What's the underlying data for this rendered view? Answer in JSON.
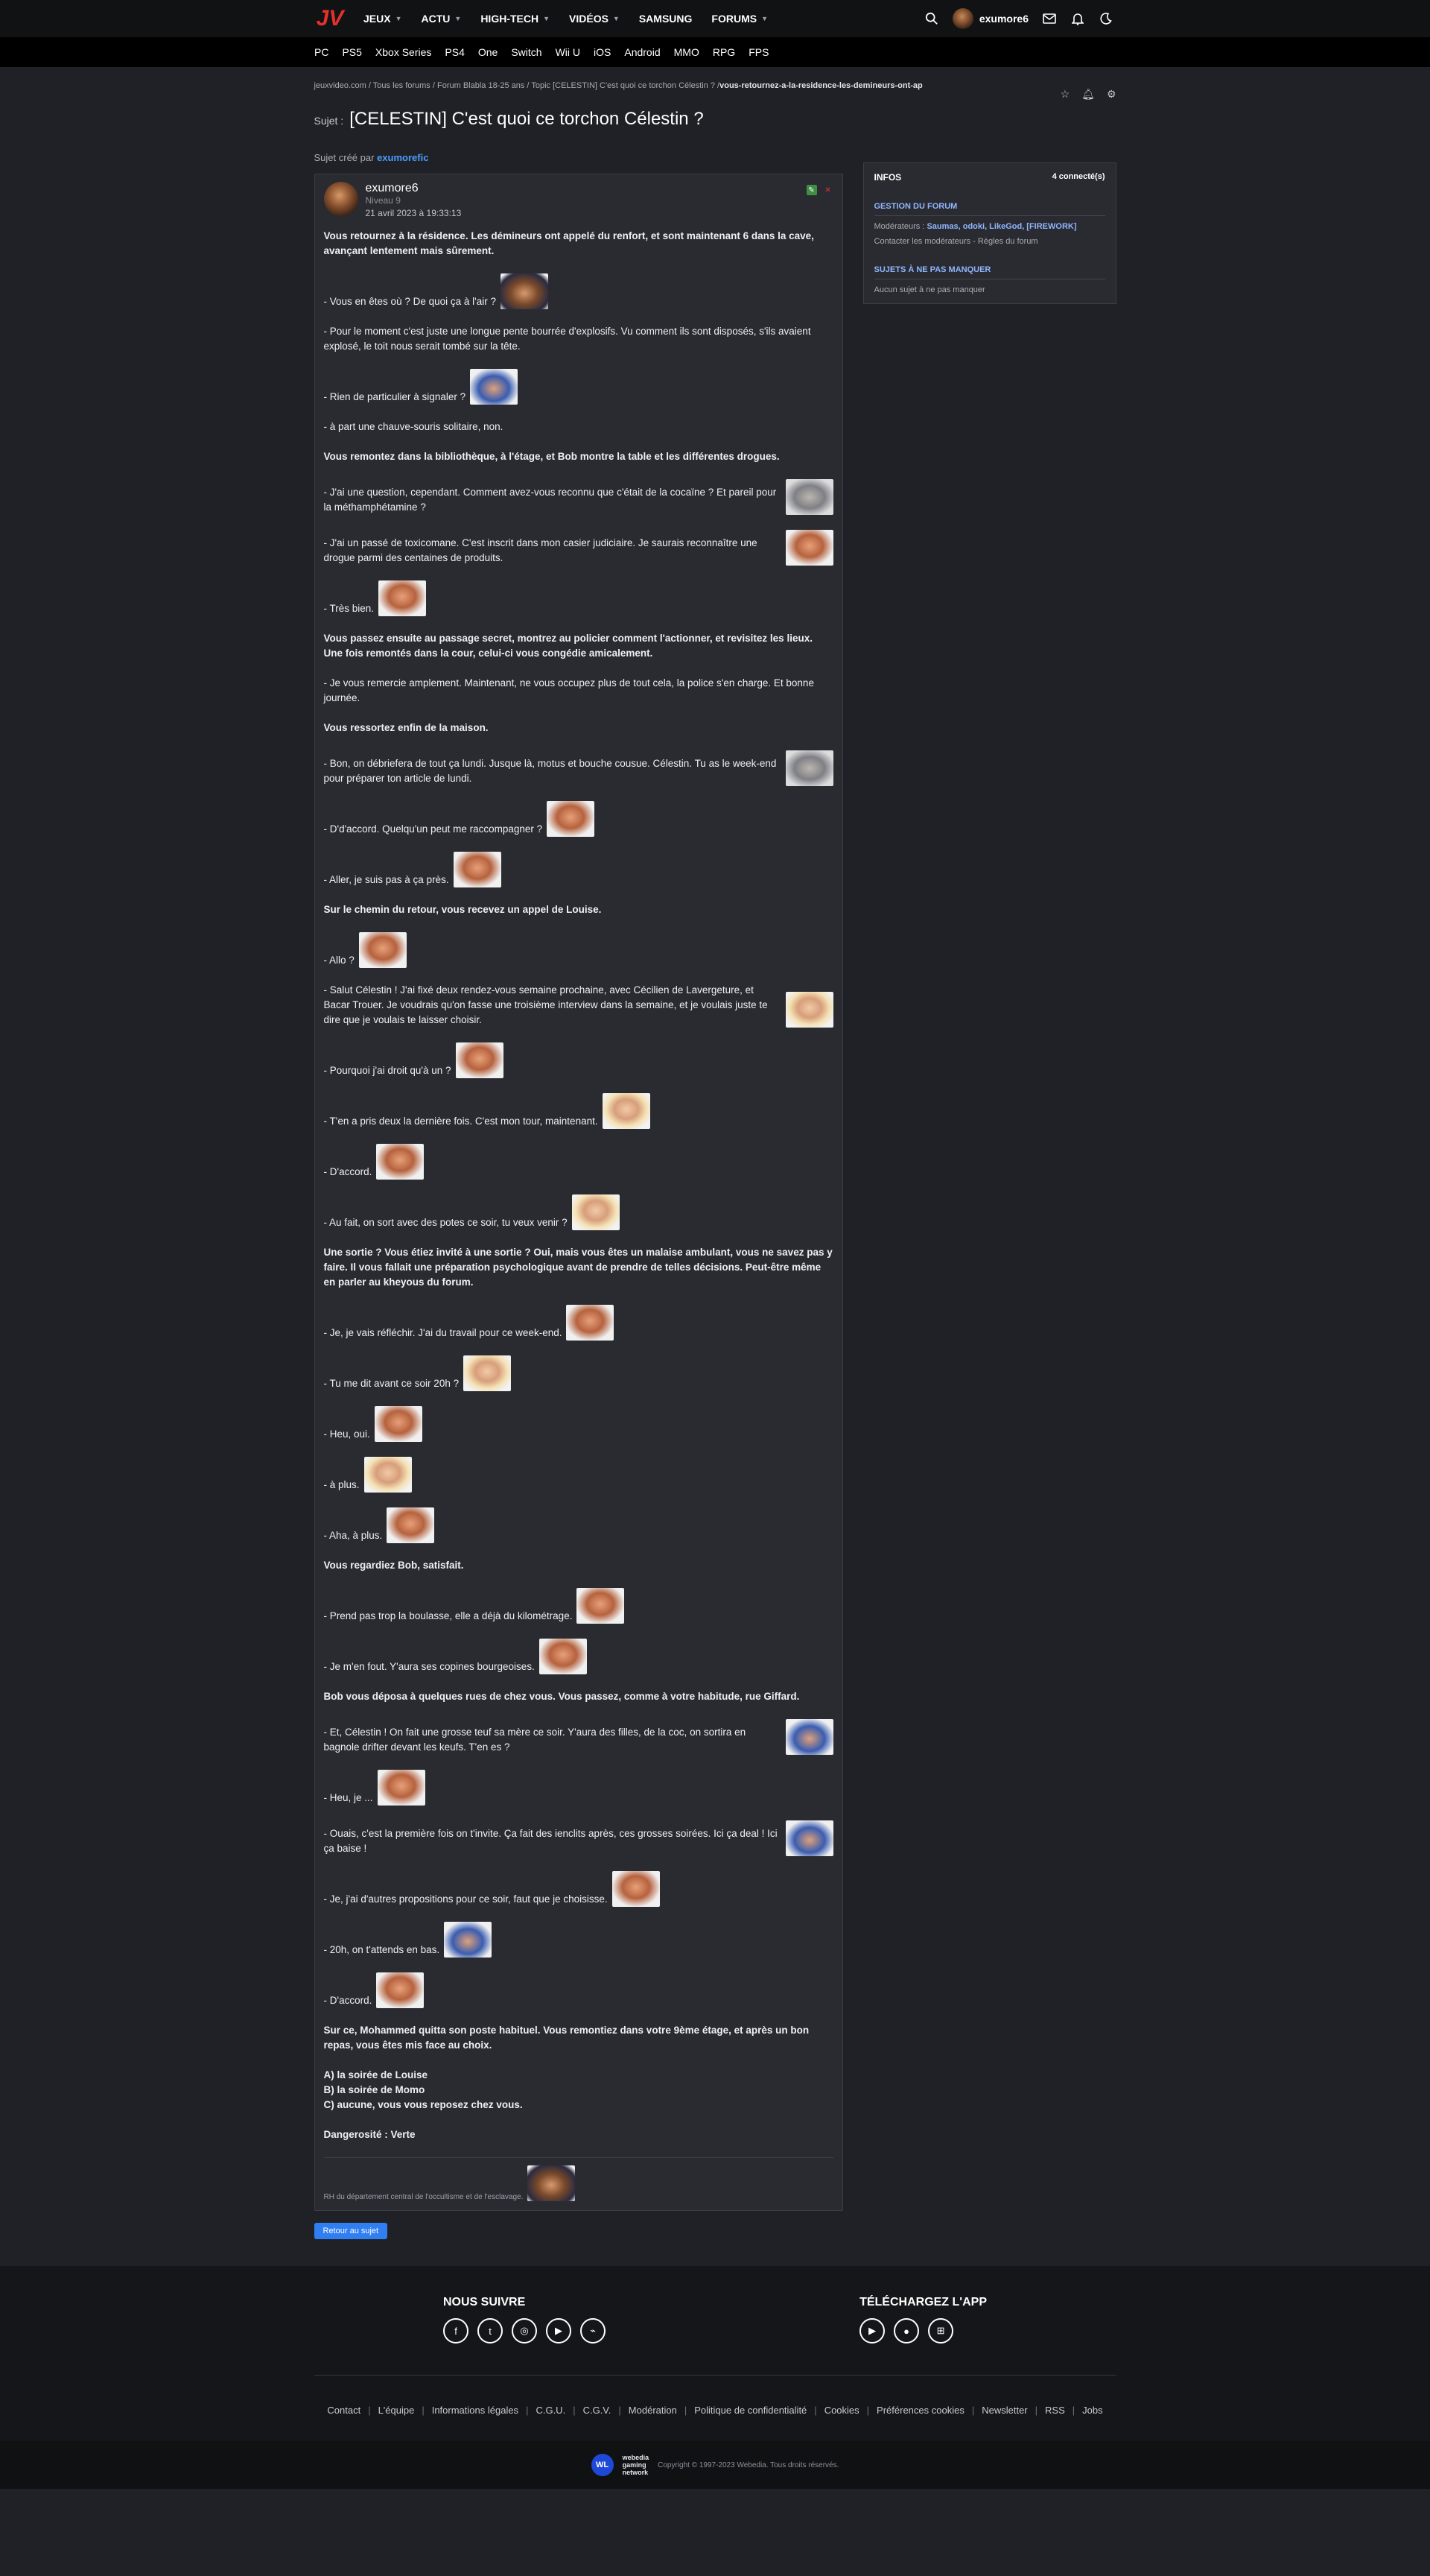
{
  "header": {
    "logo_text": "JV",
    "nav": [
      "JEUX",
      "ACTU",
      "HIGH-TECH",
      "VIDÉOS",
      "SAMSUNG",
      "FORUMS"
    ],
    "username": "exumore6"
  },
  "platforms": [
    "PC",
    "PS5",
    "Xbox Series",
    "PS4",
    "One",
    "Switch",
    "Wii U",
    "iOS",
    "Android",
    "MMO",
    "RPG",
    "FPS"
  ],
  "breadcrumb": {
    "path": "jeuxvideo.com / Tous les forums / Forum Blabla 18-25 ans / Topic [CELESTIN] C'est quoi ce torchon Célestin ? / ",
    "current": "vous-retournez-a-la-residence-les-demineurs-ont-ap"
  },
  "topic": {
    "label": "Sujet :",
    "title": "[CELESTIN] C'est quoi ce torchon Célestin ?",
    "created_by_label": "Sujet créé par",
    "created_by": "exumorefic"
  },
  "post": {
    "author": "exumore6",
    "level": "Niveau 9",
    "date": "21 avril 2023 à 19:33:13",
    "lines": [
      {
        "t": "Vous retournez à la résidence. Les démineurs ont appelé du renfort, et sont maintenant 6 dans la cave, avançant lentement mais sûrement.",
        "b": true
      },
      {
        "t": "- Vous en êtes où ? De quoi ça à l'air ?",
        "s": "d"
      },
      {
        "t": "- Pour le moment c'est juste une longue pente bourrée d'explosifs. Vu comment ils sont disposés, s'ils avaient explosé, le toit nous serait tombé sur la tête."
      },
      {
        "t": "- Rien de particulier à signaler ?",
        "s": "c"
      },
      {
        "t": "- à part une chauve-souris solitaire, non."
      },
      {
        "t": "Vous remontez dans la bibliothèque, à l'étage, et Bob montre la table et les différentes drogues.",
        "b": true
      },
      {
        "t": "- J'ai une question, cependant. Comment avez-vous reconnu que c'était de la cocaïne ? Et pareil pour la méthamphétamine ?",
        "s": "gr"
      },
      {
        "t": "- J'ai un passé de toxicomane. C'est inscrit dans mon casier judiciaire. Je saurais reconnaître une drogue parmi des centaines de produits.",
        "s": "r"
      },
      {
        "t": "- Très bien.",
        "s": "r"
      },
      {
        "t": "Vous passez ensuite au passage secret, montrez au policier comment l'actionner, et revisitez les lieux. Une fois remontés dans la cour, celui-ci vous congédie amicalement.",
        "b": true
      },
      {
        "t": "- Je vous remercie amplement. Maintenant, ne vous occupez plus de tout cela, la police s'en charge. Et bonne journée."
      },
      {
        "t": "Vous ressortez enfin de la maison.",
        "b": true
      },
      {
        "t": "- Bon, on débriefera de tout ça lundi. Jusque là, motus et bouche cousue. Célestin. Tu as le week-end pour préparer ton article de lundi.",
        "s": "gr"
      },
      {
        "t": "- D'd'accord. Quelqu'un peut me raccompagner ?",
        "s": "r"
      },
      {
        "t": "- Aller, je suis pas à ça près.",
        "s": "r"
      },
      {
        "t": "Sur le chemin du retour, vous recevez un appel de Louise.",
        "b": true
      },
      {
        "t": "- Allo ?",
        "s": "r"
      },
      {
        "t": "- Salut Célestin ! J'ai fixé deux rendez-vous semaine prochaine, avec Cécilien de Lavergeture, et Bacar Trouer. Je voudrais qu'on fasse une troisième interview dans la semaine, et je voulais juste te dire que je voulais te laisser choisir.",
        "s": "g"
      },
      {
        "t": "- Pourquoi j'ai droit qu'à un ?",
        "s": "r"
      },
      {
        "t": "- T'en a pris deux la dernière fois. C'est mon tour, maintenant.",
        "s": "g"
      },
      {
        "t": "- D'accord.",
        "s": "r"
      },
      {
        "t": "- Au fait, on sort avec des potes ce soir, tu veux venir ?",
        "s": "g"
      },
      {
        "t": "Une sortie ? Vous étiez invité à une sortie ? Oui, mais vous êtes un malaise ambulant, vous ne savez pas y faire. Il vous fallait une préparation psychologique avant de prendre de telles décisions. Peut-être même en parler au kheyous du forum.",
        "b": true
      },
      {
        "t": "- Je, je vais réfléchir. J'ai du travail pour ce week-end.",
        "s": "r"
      },
      {
        "t": "- Tu me dit avant ce soir 20h ?",
        "s": "g"
      },
      {
        "t": "- Heu, oui.",
        "s": "r"
      },
      {
        "t": "- à plus.",
        "s": "g"
      },
      {
        "t": "- Aha, à plus.",
        "s": "r"
      },
      {
        "t": "Vous regardiez Bob, satisfait.",
        "b": true
      },
      {
        "t": "- Prend pas trop la boulasse, elle a déjà du kilométrage.",
        "s": "r"
      },
      {
        "t": "- Je m'en fout. Y'aura ses copines bourgeoises.",
        "s": "r"
      },
      {
        "t": "Bob vous déposa à quelques rues de chez vous. Vous passez, comme à votre habitude, rue Giffard.",
        "b": true
      },
      {
        "t": "- Et, Célestin ! On fait une grosse teuf sa mère ce soir. Y'aura des filles, de la coc, on sortira en bagnole drifter devant les keufs. T'en es ?",
        "s": "c"
      },
      {
        "t": "- Heu, je ...",
        "s": "r"
      },
      {
        "t": "- Ouais, c'est la première fois on t'invite. Ça fait des ienclits après, ces grosses soirées. Ici ça deal ! Ici ça baise !",
        "s": "c"
      },
      {
        "t": "- Je, j'ai d'autres propositions pour ce soir, faut que je choisisse.",
        "s": "r"
      },
      {
        "t": "- 20h, on t'attends en bas.",
        "s": "c"
      },
      {
        "t": "- D'accord.",
        "s": "r"
      },
      {
        "t": "Sur ce, Mohammed quitta son poste habituel. Vous remontiez dans votre 9ème étage, et après un bon repas, vous êtes mis face au choix.",
        "b": true
      },
      {
        "t": "A) la soirée de Louise\nB) la soirée de Momo\nC) aucune, vous vous reposez chez vous.",
        "b": true
      },
      {
        "t": "Dangerosité : Verte",
        "b": true
      }
    ],
    "signature": "RH du département central de l'occultisme et de l'esclavage."
  },
  "back_button": "Retour au sujet",
  "sidebar": {
    "title": "INFOS",
    "connected": "4 connecté(s)",
    "h1": "GESTION DU FORUM",
    "mods_label": "Modérateurs :",
    "mods": "Saumas, odoki, LikeGod, [FIREWORK]",
    "links": "Contacter les modérateurs - Règles du forum",
    "h2": "SUJETS À NE PAS MANQUER",
    "none": "Aucun sujet à ne pas manquer"
  },
  "footer": {
    "follow": "NOUS SUIVRE",
    "app": "TÉLÉCHARGEZ L'APP",
    "links": [
      "Contact",
      "L'équipe",
      "Informations légales",
      "C.G.U.",
      "C.G.V.",
      "Modération",
      "Politique de confidentialité",
      "Cookies",
      "Préférences cookies",
      "Newsletter",
      "RSS",
      "Jobs"
    ],
    "copyright": "Copyright © 1997-2023 Webedia. Tous droits réservés.",
    "brand": "WL",
    "brand_text": "webedia\ngaming\nnetwork"
  }
}
